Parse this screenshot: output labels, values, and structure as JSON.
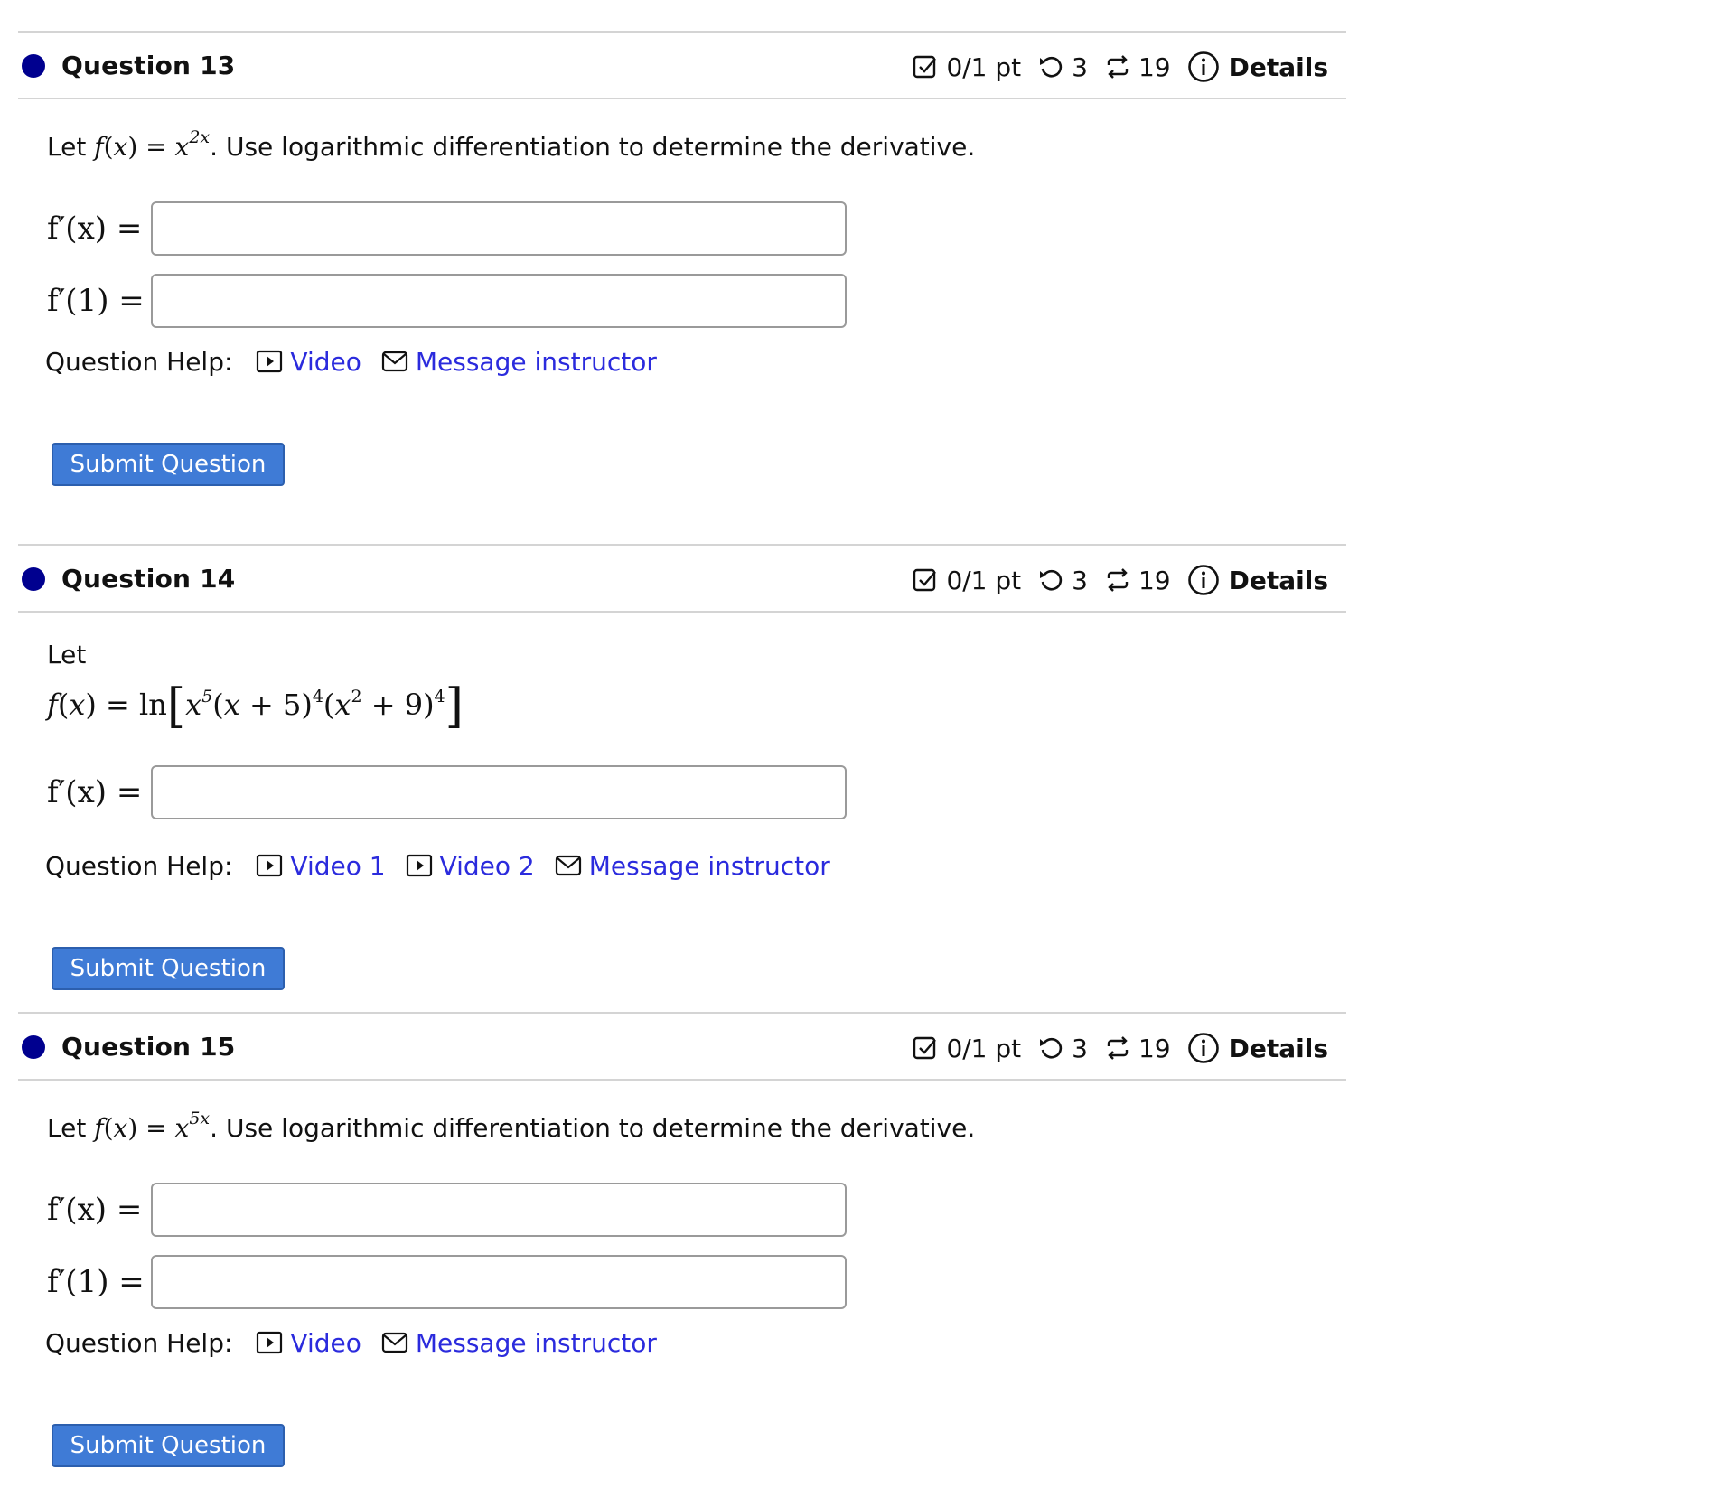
{
  "colors": {
    "link": "#2b2bdd",
    "button_bg": "#3f7bd6",
    "dot": "#00008f"
  },
  "common": {
    "score": "0/1 pt",
    "retries": "3",
    "attempts": "19",
    "details": "Details",
    "help_label": "Question Help:",
    "message_instructor": "Message instructor",
    "submit": "Submit Question"
  },
  "q13": {
    "title": "Question 13",
    "prompt_let": "Let",
    "prompt_rest": ". Use logarithmic differentiation to determine the derivative.",
    "answers": [
      "f′(x) =",
      "f′(1) ="
    ],
    "video": "Video"
  },
  "q14": {
    "title": "Question 14",
    "prompt_let": "Let",
    "answers": [
      "f′(x) ="
    ],
    "video1": "Video 1",
    "video2": "Video 2"
  },
  "q15": {
    "title": "Question 15",
    "prompt_let": "Let",
    "prompt_rest": ". Use logarithmic differentiation to determine the derivative.",
    "answers": [
      "f′(x) =",
      "f′(1) ="
    ],
    "video": "Video"
  },
  "icons": [
    "checkbox-icon",
    "retry-icon",
    "attempts-icon",
    "info-icon",
    "video-icon",
    "mail-icon"
  ]
}
